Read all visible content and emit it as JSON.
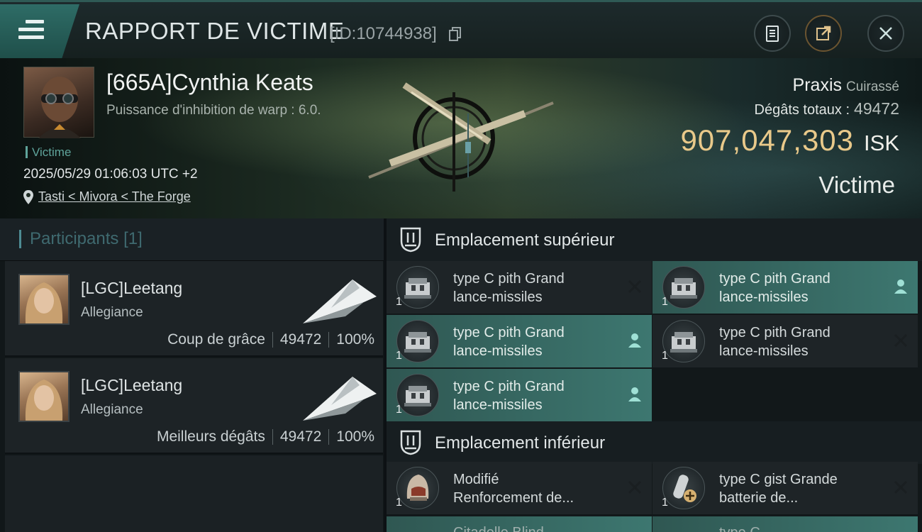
{
  "header": {
    "title": "RAPPORT DE VICTIME",
    "id_text": "[ID:10744938]",
    "icons": [
      "menu-icon",
      "copy-icon",
      "clipboard-icon",
      "share-icon",
      "close-icon"
    ]
  },
  "victim": {
    "name": "[665A]Cynthia Keats",
    "warp_text": "Puissance d'inhibition de warp : 6.0.",
    "tag": "Victime",
    "time": "2025/05/29 01:06:03 UTC +2",
    "location": "Tasti < Mivora < The Forge",
    "ship_name": "Praxis",
    "ship_class": "Cuirassé",
    "damage_label": "Dégâts totaux :",
    "damage_value": "49472",
    "isk_value": "907,047,303",
    "isk_unit": "ISK",
    "status": "Victime"
  },
  "participants": {
    "label": "Participants",
    "count": "[1]",
    "rows": [
      {
        "name": "[LGC]Leetang",
        "corp": "Allegiance",
        "role": "Coup de grâce",
        "damage": "49472",
        "percent": "100%"
      },
      {
        "name": "[LGC]Leetang",
        "corp": "Allegiance",
        "role": "Meilleurs dégâts",
        "damage": "49472",
        "percent": "100%"
      }
    ]
  },
  "slots": {
    "high_label": "Emplacement supérieur",
    "low_label": "Emplacement inférieur",
    "high": [
      {
        "line1": "type C pith Grand",
        "line2": "lance-missiles",
        "qty": "1",
        "state": "destroyed",
        "icon": "missile-launcher-icon"
      },
      {
        "line1": "type C pith Grand",
        "line2": "lance-missiles",
        "qty": "1",
        "state": "dropped",
        "icon": "missile-launcher-icon"
      },
      {
        "line1": "type C pith Grand",
        "line2": "lance-missiles",
        "qty": "1",
        "state": "dropped",
        "icon": "missile-launcher-icon"
      },
      {
        "line1": "type C pith Grand",
        "line2": "lance-missiles",
        "qty": "1",
        "state": "destroyed",
        "icon": "missile-launcher-icon"
      },
      {
        "line1": "type C pith Grand",
        "line2": "lance-missiles",
        "qty": "1",
        "state": "dropped",
        "icon": "missile-launcher-icon"
      }
    ],
    "low": [
      {
        "line1": "Modifié",
        "line2": "Renforcement de...",
        "qty": "1",
        "state": "destroyed",
        "icon": "armor-helmet-icon"
      },
      {
        "line1": "type C gist Grande",
        "line2": "batterie de...",
        "qty": "1",
        "state": "destroyed",
        "icon": "capacitor-battery-icon"
      }
    ],
    "partial_row_text": [
      "Citadelle Blind...",
      "type C..."
    ]
  },
  "colors": {
    "accent_teal": "#3d7770",
    "isk_gold": "#e9c98a",
    "dropped_icon": "#9fe0d5"
  }
}
